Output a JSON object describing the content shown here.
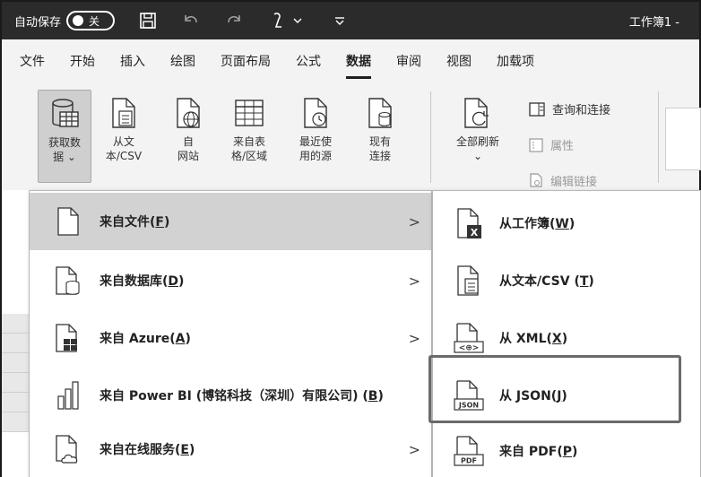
{
  "titlebar": {
    "autosave_label": "自动保存",
    "autosave_state": "关",
    "workbook_title": "工作簿1 -"
  },
  "menubar": {
    "tabs": [
      {
        "label": "文件"
      },
      {
        "label": "开始"
      },
      {
        "label": "插入"
      },
      {
        "label": "绘图"
      },
      {
        "label": "页面布局"
      },
      {
        "label": "公式"
      },
      {
        "label": "数据",
        "active": true
      },
      {
        "label": "审阅"
      },
      {
        "label": "视图"
      },
      {
        "label": "加载项"
      }
    ]
  },
  "ribbon": {
    "get_data": {
      "line1": "获取数",
      "line2": "据 ⌄"
    },
    "from_text": {
      "line1": "从文",
      "line2": "本/CSV"
    },
    "from_web": {
      "line1": "自",
      "line2": "网站"
    },
    "from_table": {
      "line1": "来自表",
      "line2": "格/区域"
    },
    "recent_sources": {
      "line1": "最近使",
      "line2": "用的源"
    },
    "existing_connections": {
      "line1": "现有",
      "line2": "连接"
    },
    "refresh_all": {
      "line1": "全部刷新",
      "line2": "⌄"
    },
    "queries_connections": "查询和连接",
    "properties": "属性",
    "edit_links": "编辑链接"
  },
  "menu_left": {
    "items": [
      {
        "label": "来自文件(",
        "key": "F",
        "suffix": ")",
        "arrow": ">",
        "icon": "file-icon"
      },
      {
        "label": "来自数据库(",
        "key": "D",
        "suffix": ")",
        "arrow": ">",
        "icon": "database-icon"
      },
      {
        "label": "来自 Azure(",
        "key": "A",
        "suffix": ")",
        "arrow": ">",
        "icon": "azure-icon"
      },
      {
        "label": "来自 Power BI (博铭科技（深圳）有限公司) (",
        "key": "B",
        "suffix": ")",
        "arrow": "",
        "icon": "powerbi-icon"
      },
      {
        "label": "来自在线服务(",
        "key": "E",
        "suffix": ")",
        "arrow": ">",
        "icon": "cloud-file-icon"
      }
    ]
  },
  "menu_right": {
    "items": [
      {
        "label": "从工作簿(",
        "key": "W",
        "suffix": ")",
        "icon": "excel-file-icon"
      },
      {
        "label": "从文本/CSV (",
        "key": "T",
        "suffix": ")",
        "icon": "text-file-icon"
      },
      {
        "label": "从 XML(",
        "key": "X",
        "suffix": ")",
        "icon": "xml-file-icon"
      },
      {
        "label": "从 JSON(",
        "key": "J",
        "suffix": ")",
        "icon": "json-file-icon"
      },
      {
        "label": "来自 PDF(",
        "key": "P",
        "suffix": ")",
        "icon": "pdf-file-icon"
      }
    ]
  },
  "icon_labels": {
    "xml": "<⊕>",
    "json": "JSON",
    "pdf": "PDF",
    "excel": "X"
  }
}
